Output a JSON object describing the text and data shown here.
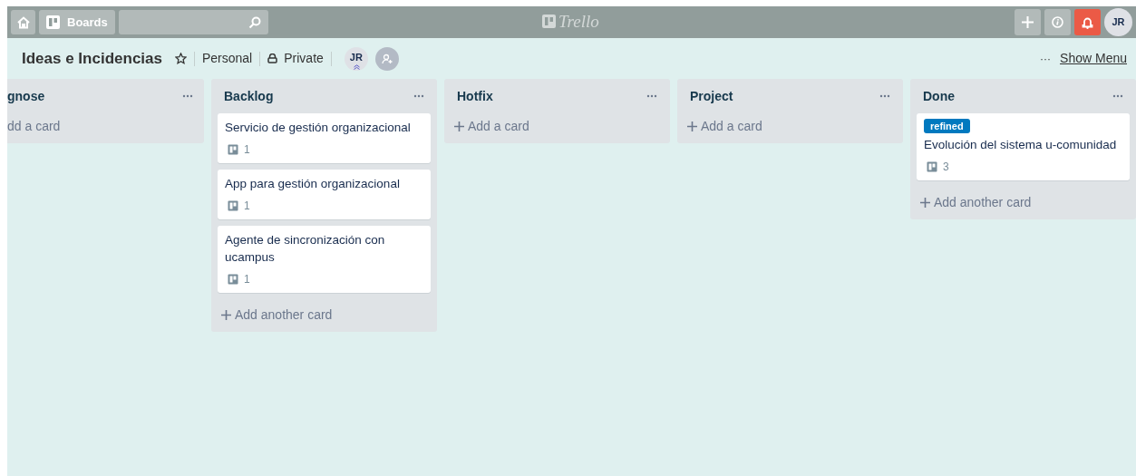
{
  "header": {
    "boards_label": "Boards",
    "logo": "Trello",
    "avatar": "JR"
  },
  "board": {
    "title": "Ideas e Incidencias",
    "visibility_team": "Personal",
    "visibility": "Private",
    "member": "JR",
    "menu_dots": "···",
    "show_menu": "Show Menu"
  },
  "lists": [
    {
      "title": "gnose",
      "cut": true,
      "add_label": "dd a card"
    },
    {
      "title": "Backlog",
      "cut": false,
      "cards": [
        {
          "title": "Servicio de gestión organizacional",
          "count": "1"
        },
        {
          "title": "App para gestión organizacional",
          "count": "1"
        },
        {
          "title": "Agente de sincronización con ucampus",
          "count": "1"
        }
      ],
      "add_label": "Add another card"
    },
    {
      "title": "Hotfix",
      "cut": false,
      "add_label": "Add a card"
    },
    {
      "title": "Project",
      "cut": false,
      "add_label": "Add a card"
    },
    {
      "title": "Done",
      "cut": false,
      "cards": [
        {
          "label": "refined",
          "color": "#0079bf",
          "title": "Evolución del sistema u-comunidad",
          "count": "3"
        }
      ],
      "add_label": "Add another card"
    }
  ]
}
